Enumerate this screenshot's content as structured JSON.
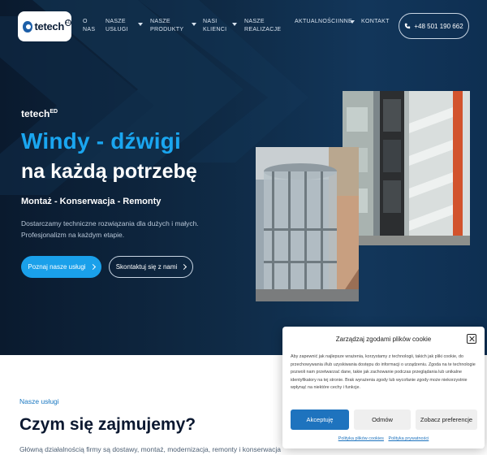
{
  "header": {
    "logo_text": "tetech",
    "logo_sup": "ED",
    "nav": [
      {
        "label_line1": "O",
        "label_line2": "NAS"
      },
      {
        "label_line1": "NASZE",
        "label_line2": "USŁUGI"
      },
      {
        "label_line1": "NASZE",
        "label_line2": "PRODUKTY"
      },
      {
        "label_line1": "NASI",
        "label_line2": "KLIENCI"
      },
      {
        "label_line1": "NASZE",
        "label_line2": "REALIZACJE"
      },
      {
        "label_line1": "AKTUALNOŚCI",
        "label_line2": ""
      },
      {
        "label_line1": "INNE",
        "label_line2": ""
      },
      {
        "label_line1": "KONTAKT",
        "label_line2": ""
      }
    ],
    "phone": "+48 501 190 662"
  },
  "hero": {
    "brand": "tetech",
    "brand_sup": "ED",
    "headline_1": "Windy - dźwigi",
    "headline_2": "na każdą potrzebę",
    "services": "Montaż - Konserwacja - Remonty",
    "description_1": "Dostarczamy techniczne rozwiązania dla dużych i małych.",
    "description_2": "Profesjonalizm na każdym etapie.",
    "btn_primary": "Poznaj nasze usługi",
    "btn_secondary": "Skontaktuj się z nami"
  },
  "section": {
    "label": "Nasze usługi",
    "title": "Czym się zajmujemy?",
    "text": "Główną działalnością firmy są dostawy, montaż, modernizacja, remonty i konserwacja"
  },
  "cookie": {
    "title": "Zarządzaj zgodami plików cookie",
    "body": "Aby zapewnić jak najlepsze wrażenia, korzystamy z technologii, takich jak pliki cookie, do przechowywania i/lub uzyskiwania dostępu do informacji o urządzeniu. Zgoda na te technologie pozwoli nam przetwarzać dane, takie jak zachowanie podczas przeglądania lub unikalne identyfikatory na tej stronie. Brak wyrażenia zgody lub wycofanie zgody może niekorzystnie wpłynąć na niektóre cechy i funkcje.",
    "accept": "Akceptuję",
    "deny": "Odmów",
    "preferences": "Zobacz preferencje",
    "link_cookies": "Polityka plików cookies",
    "link_privacy": "Polityka prywatności"
  },
  "colors": {
    "accent": "#1aa6f0",
    "hero_bg": "#0f2a45",
    "cookie_accept": "#1e73be"
  }
}
